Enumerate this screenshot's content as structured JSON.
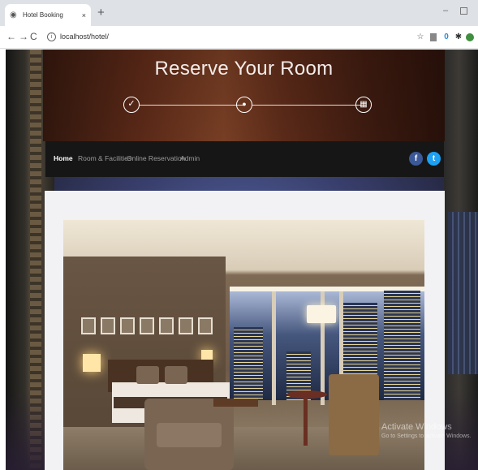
{
  "browser": {
    "tab_title": "Hotel Booking",
    "tab_close": "×",
    "new_tab": "+",
    "url": "localhost/hotel/",
    "minimize": "–"
  },
  "hero": {
    "title": "Reserve Your Room",
    "steps": [
      {
        "icon": "check-icon",
        "glyph": "✓"
      },
      {
        "icon": "user-icon",
        "glyph": "●"
      },
      {
        "icon": "calendar-icon",
        "glyph": "▦"
      }
    ]
  },
  "nav": {
    "items": [
      {
        "label": "Home",
        "active": true
      },
      {
        "label": "Room & Facilities",
        "active": false
      },
      {
        "label": "Online Reservation",
        "active": false
      },
      {
        "label": "Admin",
        "active": false
      }
    ],
    "social": [
      {
        "icon": "facebook-icon",
        "glyph": "f",
        "color": "#3b5998"
      },
      {
        "icon": "twitter-icon",
        "glyph": "t",
        "color": "#1da1f2"
      }
    ]
  },
  "watermark": {
    "title": "Activate Windows",
    "subtitle": "Go to Settings to activate Windows."
  },
  "colors": {
    "navbar": "#161616",
    "card": "#f2f2f4",
    "tabbar": "#dee1e6"
  }
}
